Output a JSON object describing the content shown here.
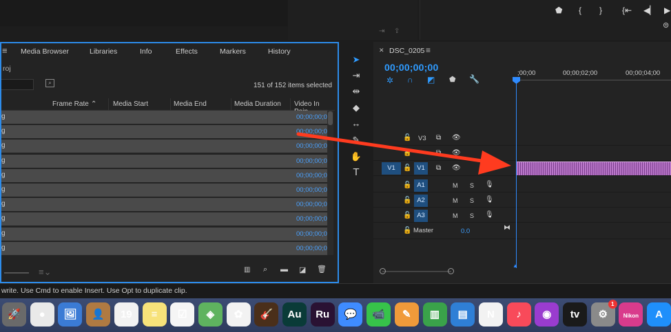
{
  "project_panel": {
    "tabs": [
      "Media Browser",
      "Libraries",
      "Info",
      "Effects",
      "Markers",
      "History"
    ],
    "project_name_fragment": "roj",
    "items_count": "151 of 152 items selected",
    "columns": [
      "Frame Rate",
      "Media Start",
      "Media End",
      "Media Duration",
      "Video In Poin"
    ],
    "row_name_fragment": "g",
    "row_timecode": "00;00;00;0",
    "row_count": 10
  },
  "timeline": {
    "sequence_name": "DSC_0205",
    "current_timecode": "00;00;00;00",
    "ruler_labels": [
      ";00;00",
      "00;00;02;00",
      "00;00;04;00"
    ],
    "video_tracks": [
      {
        "label": "V3",
        "source": ""
      },
      {
        "label": "V2",
        "source": ""
      },
      {
        "label": "V1",
        "source": "V1"
      }
    ],
    "audio_tracks": [
      {
        "label": "A1",
        "m": "M",
        "s": "S"
      },
      {
        "label": "A2",
        "m": "M",
        "s": "S"
      },
      {
        "label": "A3",
        "m": "M",
        "s": "S"
      }
    ],
    "master_label": "Master",
    "master_value": "0.0"
  },
  "status_bar": {
    "text": "write. Use Cmd to enable Insert. Use Opt to duplicate clip."
  },
  "dock": {
    "apps": [
      {
        "name": "Launchpad",
        "glyph": "🚀"
      },
      {
        "name": "Chrome",
        "glyph": "●"
      },
      {
        "name": "Preview",
        "glyph": "🖼"
      },
      {
        "name": "Contacts",
        "glyph": "👤"
      },
      {
        "name": "Calendar",
        "glyph": "19",
        "month": "MAR"
      },
      {
        "name": "Notes",
        "glyph": "≡"
      },
      {
        "name": "Reminders",
        "glyph": "☑"
      },
      {
        "name": "Maps",
        "glyph": "◈"
      },
      {
        "name": "Photos",
        "glyph": "✿"
      },
      {
        "name": "GarageBand",
        "glyph": "🎸"
      },
      {
        "name": "Audition",
        "glyph": "Au"
      },
      {
        "name": "Premiere Rush",
        "glyph": "Ru"
      },
      {
        "name": "Messages",
        "glyph": "💬"
      },
      {
        "name": "FaceTime",
        "glyph": "📹"
      },
      {
        "name": "Pages",
        "glyph": "✎"
      },
      {
        "name": "Numbers",
        "glyph": "▥"
      },
      {
        "name": "Keynote",
        "glyph": "▤"
      },
      {
        "name": "News",
        "glyph": "N"
      },
      {
        "name": "Music",
        "glyph": "♪"
      },
      {
        "name": "Podcasts",
        "glyph": "◉"
      },
      {
        "name": "TV",
        "glyph": "tv"
      },
      {
        "name": "System Preferences",
        "glyph": "⚙",
        "badge": "1"
      },
      {
        "name": "Nikon",
        "glyph": "Nikon"
      },
      {
        "name": "App Store",
        "glyph": "A"
      }
    ]
  },
  "colors": {
    "accent": "#2d8ceb",
    "timecode": "#2f9bff",
    "clip": "#b976c8",
    "arrow": "#ff3b1f"
  }
}
